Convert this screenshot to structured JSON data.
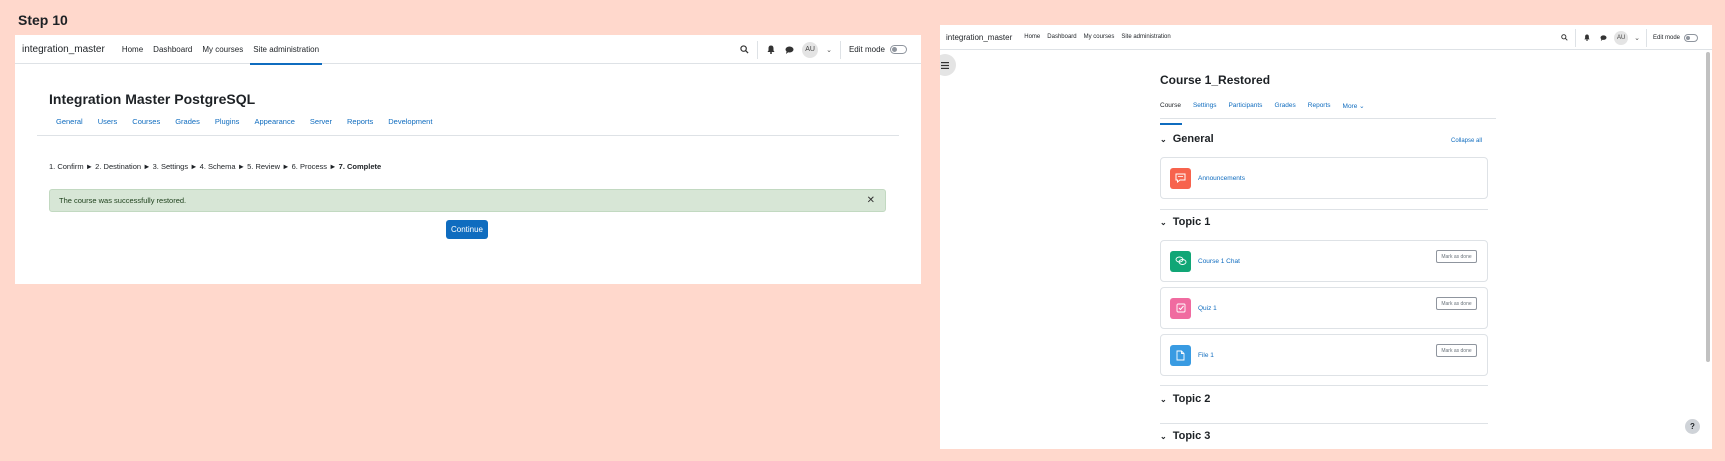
{
  "step_label": "Step 10",
  "left": {
    "brand": "integration_master",
    "nav": [
      "Home",
      "Dashboard",
      "My courses",
      "Site administration"
    ],
    "edit_mode": "Edit mode",
    "avatar": "AU",
    "page_title": "Integration Master PostgreSQL",
    "admin_tabs": [
      "General",
      "Users",
      "Courses",
      "Grades",
      "Plugins",
      "Appearance",
      "Server",
      "Reports",
      "Development"
    ],
    "steps_text": "1. Confirm ► 2. Destination ► 3. Settings ► 4. Schema ► 5. Review ► 6. Process ► ",
    "steps_current": "7. Complete",
    "alert": "The course was successfully restored.",
    "continue": "Continue"
  },
  "right": {
    "brand": "integration_master",
    "nav": [
      "Home",
      "Dashboard",
      "My courses",
      "Site administration"
    ],
    "edit_mode": "Edit mode",
    "avatar": "AU",
    "course_title": "Course 1_Restored",
    "tabs": [
      "Course",
      "Settings",
      "Participants",
      "Grades",
      "Reports",
      "More"
    ],
    "collapse_all": "Collapse all",
    "sections": [
      "General",
      "Topic 1",
      "Topic 2",
      "Topic 3"
    ],
    "activities": [
      {
        "name": "Announcements",
        "icon": "forum-icon",
        "color": "#f7634d"
      },
      {
        "name": "Course 1 Chat",
        "icon": "chat-icon",
        "color": "#11a676"
      },
      {
        "name": "Quiz 1",
        "icon": "quiz-icon",
        "color": "#f06ba0"
      },
      {
        "name": "File 1",
        "icon": "file-icon",
        "color": "#399be2"
      }
    ],
    "mark_as_done": "Mark as done",
    "help": "?"
  },
  "colors": {
    "accent": "#0f6cbf",
    "background": "#ffd8cc",
    "success_bg": "#d7e6d6"
  }
}
